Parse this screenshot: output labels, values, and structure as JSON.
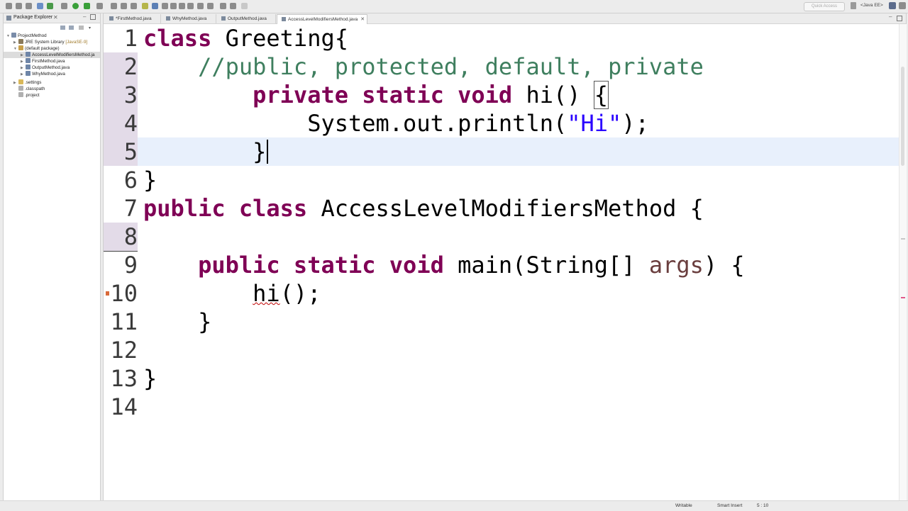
{
  "toolbar": {
    "quick_access_placeholder": "Quick Access",
    "perspective_label": "<Java EE>"
  },
  "package_explorer": {
    "title": "Package Explorer",
    "close_glyph": "✕",
    "tree": [
      {
        "label": "ProjectMethod",
        "suffix": ""
      },
      {
        "label": "JRE System Library",
        "suffix": "[JavaSE-9]"
      },
      {
        "label": "(default package)",
        "suffix": ""
      },
      {
        "label": "AccessLevelModifiersMethod.ja",
        "suffix": ""
      },
      {
        "label": "FirstMethod.java",
        "suffix": ""
      },
      {
        "label": "OutputMethod.java",
        "suffix": ""
      },
      {
        "label": "WhyMethod.java",
        "suffix": ""
      },
      {
        "label": ".settings",
        "suffix": ""
      },
      {
        "label": ".classpath",
        "suffix": ""
      },
      {
        "label": ".project",
        "suffix": ""
      }
    ]
  },
  "editor": {
    "tabs": [
      {
        "label": "*FirstMethod.java"
      },
      {
        "label": "WhyMethod.java"
      },
      {
        "label": "OutputMethod.java"
      },
      {
        "label": "AccessLevelModifiersMethod.java"
      }
    ],
    "tab_close_glyph": "✕",
    "line_numbers": [
      "1",
      "2",
      "3",
      "4",
      "5",
      "6",
      "7",
      "8",
      "9",
      "10",
      "11",
      "12",
      "13",
      "14"
    ],
    "code": {
      "l1_kw": "class",
      "l1_rest": " Greeting{",
      "l2_comment": "//public, protected, default, private",
      "l3_kw1": "private",
      "l3_kw2": "static",
      "l3_kw3": "void",
      "l3_rest": " hi() ",
      "l3_brace": "{",
      "l4_pre": "System.out.println(",
      "l4_str": "\"Hi\"",
      "l4_post": ");",
      "l5_brace": "}",
      "l6_brace": "}",
      "l7_kw1": "public",
      "l7_kw2": "class",
      "l7_rest": " AccessLevelModifiersMethod {",
      "l9_kw1": "public",
      "l9_kw2": "static",
      "l9_kw3": "void",
      "l9_rest1": " main(String[] ",
      "l9_var": "args",
      "l9_rest2": ") {",
      "l10_err": "hi",
      "l10_rest": "();",
      "l11_brace": "}",
      "l13_brace": "}"
    }
  },
  "status_bar": {
    "writable": "Writable",
    "insert_mode": "Smart Insert",
    "position": "5 : 10"
  },
  "colors": {
    "keyword": "#7f0055",
    "comment": "#3f7f5f",
    "string": "#2a00ff",
    "current_line": "#e8f0fc"
  }
}
